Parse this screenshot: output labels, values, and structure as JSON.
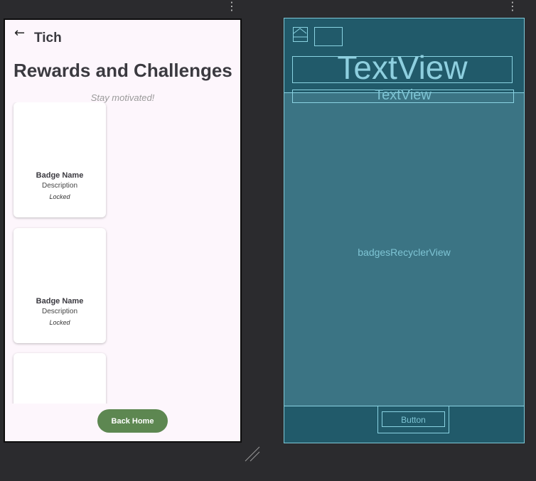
{
  "design": {
    "toolbar": {
      "back_icon": "arrow-left-icon",
      "title": "Tich"
    },
    "title": "Rewards and Challenges",
    "subtitle": "Stay motivated!",
    "badges": [
      {
        "name": "Badge Name",
        "description": "Description",
        "status": "Locked"
      },
      {
        "name": "Badge Name",
        "description": "Description",
        "status": "Locked"
      },
      {
        "name": "",
        "description": "",
        "status": ""
      }
    ],
    "button": {
      "label": "Back Home"
    },
    "colors": {
      "background": "#fdf6fc",
      "button": "#5d8751"
    }
  },
  "blueprint": {
    "title_label": "TextView",
    "subtitle_label": "TextView",
    "recycler_label": "badgesRecyclerView",
    "button_label": "Button",
    "colors": {
      "background": "#215a6a",
      "recycler": "#3b7484",
      "outline": "#8ad3e2"
    }
  }
}
